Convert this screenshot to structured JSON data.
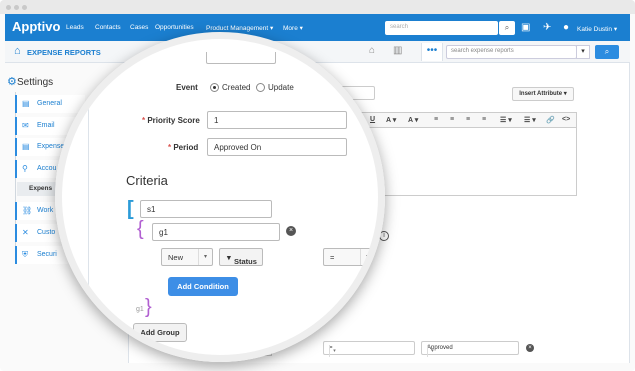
{
  "app": {
    "logo": "Apptivo",
    "nav": [
      "Leads",
      "Contacts",
      "Cases",
      "Opportunities",
      "Product Management ▾",
      "More ▾"
    ],
    "search_placeholder": "search",
    "user": "Katie Dustin ▾"
  },
  "module": {
    "title": "EXPENSE REPORTS",
    "search_placeholder": "search expense reports"
  },
  "sidebar": {
    "title": "Settings",
    "items": [
      {
        "label": "General"
      },
      {
        "label": "Email"
      },
      {
        "label": "Expense"
      },
      {
        "label": "Accou"
      },
      {
        "label": "Work"
      },
      {
        "label": "Custo"
      },
      {
        "label": "Securi"
      }
    ],
    "sub_item": "Expens"
  },
  "form": {
    "event_label": "Event",
    "event_options": [
      "Created",
      "Update"
    ],
    "event_selected": "Created",
    "priority_label": "Priority Score",
    "priority_value": "1",
    "period_label": "Period",
    "period_value": "Approved On",
    "insert_attribute": "Insert Attribute ▾",
    "toolbar": [
      "B",
      "I",
      "U",
      "A ▾",
      "A ▾",
      "≡",
      "≡",
      "≡",
      "≡",
      "☰ ▾",
      "☰ ▾",
      "🔗",
      "<>"
    ]
  },
  "criteria": {
    "title": "Criteria",
    "s_value": "s1",
    "g_value": "g1",
    "field_value": "New",
    "status_label": "Status",
    "operator_value": "=",
    "add_condition": "Add Condition",
    "add_group": "Add Group",
    "group_close_label": "g1"
  },
  "background_row": {
    "operator": "=",
    "value": "Approved"
  }
}
